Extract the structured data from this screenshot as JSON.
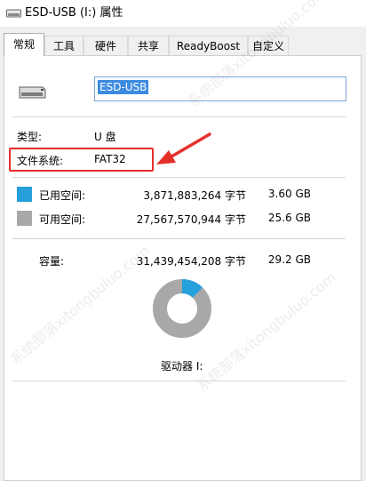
{
  "window": {
    "title": "ESD-USB (I:) 属性"
  },
  "tabs": [
    {
      "label": "常规"
    },
    {
      "label": "工具"
    },
    {
      "label": "硬件"
    },
    {
      "label": "共享"
    },
    {
      "label": "ReadyBoost"
    },
    {
      "label": "自定义"
    }
  ],
  "drive": {
    "name_value": "ESD-USB",
    "type_label": "类型:",
    "type_value": "U 盘",
    "fs_label": "文件系统:",
    "fs_value": "FAT32"
  },
  "space": {
    "used_label": "已用空间:",
    "used_bytes": "3,871,883,264 字节",
    "used_size": "3.60 GB",
    "free_label": "可用空间:",
    "free_bytes": "27,567,570,944 字节",
    "free_size": "25.6 GB",
    "capacity_label": "容量:",
    "capacity_bytes": "31,439,454,208 字节",
    "capacity_size": "29.2 GB",
    "used_fraction": 0.123,
    "used_color": "#26a0da",
    "free_color": "#a8a8a8"
  },
  "drive_letter_label": "驱动器 I:",
  "watermark_text": "系统部落xitongbuluo.com",
  "annotation_color": "#e5302a"
}
